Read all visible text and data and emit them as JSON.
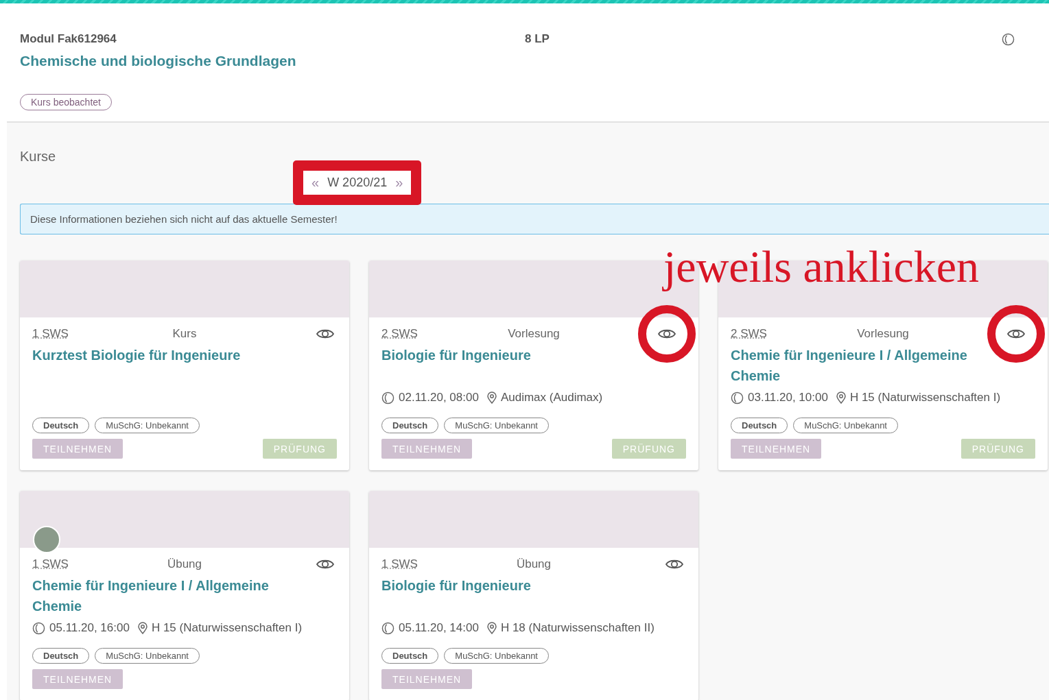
{
  "module": {
    "code": "Modul Fak612964",
    "credits": "8 LP",
    "title": "Chemische und biologische Grundlagen",
    "badge": "Kurs beobachtet"
  },
  "courses": {
    "heading": "Kurse",
    "semester": {
      "prev": "«",
      "label": "W 2020/21",
      "next": "»",
      "highlighted": true
    },
    "notice": "Diese Informationen beziehen sich nicht auf das aktuelle Semester!",
    "annotation": "jeweils anklicken",
    "cards": [
      {
        "sws": "1 SWS",
        "type": "Kurs",
        "title": "Kurztest Biologie für Ingenieure",
        "avatar": false,
        "eye_circled": false,
        "tags": [
          {
            "label": "Deutsch",
            "kind": "language"
          },
          {
            "label": "MuSchG: Unbekannt",
            "kind": "info"
          }
        ],
        "buttons": [
          {
            "label": "TEILNEHMEN",
            "kind": "join"
          },
          {
            "label": "PRÜFUNG",
            "kind": "exam"
          }
        ]
      },
      {
        "sws": "2 SWS",
        "type": "Vorlesung",
        "title": "Biologie für Ingenieure",
        "avatar": false,
        "eye_circled": true,
        "date": "02.11.20, 08:00",
        "location": "Audimax (Audimax)",
        "tags": [
          {
            "label": "Deutsch",
            "kind": "language"
          },
          {
            "label": "MuSchG: Unbekannt",
            "kind": "info"
          }
        ],
        "buttons": [
          {
            "label": "TEILNEHMEN",
            "kind": "join"
          },
          {
            "label": "PRÜFUNG",
            "kind": "exam"
          }
        ]
      },
      {
        "sws": "2 SWS",
        "type": "Vorlesung",
        "title": "Chemie für Ingenieure I / Allgemeine Chemie",
        "avatar": false,
        "eye_circled": true,
        "date": "03.11.20, 10:00",
        "location": "H 15 (Naturwissenschaften I)",
        "tags": [
          {
            "label": "Deutsch",
            "kind": "language"
          },
          {
            "label": "MuSchG: Unbekannt",
            "kind": "info"
          }
        ],
        "buttons": [
          {
            "label": "TEILNEHMEN",
            "kind": "join"
          },
          {
            "label": "PRÜFUNG",
            "kind": "exam"
          }
        ]
      },
      {
        "sws": "1 SWS",
        "type": "Übung",
        "title": "Chemie für Ingenieure I / Allgemeine Chemie",
        "avatar": true,
        "eye_circled": false,
        "date": "05.11.20, 16:00",
        "location": "H 15 (Naturwissenschaften I)",
        "tags": [
          {
            "label": "Deutsch",
            "kind": "language"
          },
          {
            "label": "MuSchG: Unbekannt",
            "kind": "info"
          }
        ],
        "buttons": [
          {
            "label": "TEILNEHMEN",
            "kind": "join"
          }
        ]
      },
      {
        "sws": "1 SWS",
        "type": "Übung",
        "title": "Biologie für Ingenieure",
        "avatar": false,
        "eye_circled": false,
        "date": "05.11.20, 14:00",
        "location": "H 18 (Naturwissenschaften II)",
        "tags": [
          {
            "label": "Deutsch",
            "kind": "language"
          },
          {
            "label": "MuSchG: Unbekannt",
            "kind": "info"
          }
        ],
        "buttons": [
          {
            "label": "TEILNEHMEN",
            "kind": "join"
          }
        ]
      }
    ]
  }
}
